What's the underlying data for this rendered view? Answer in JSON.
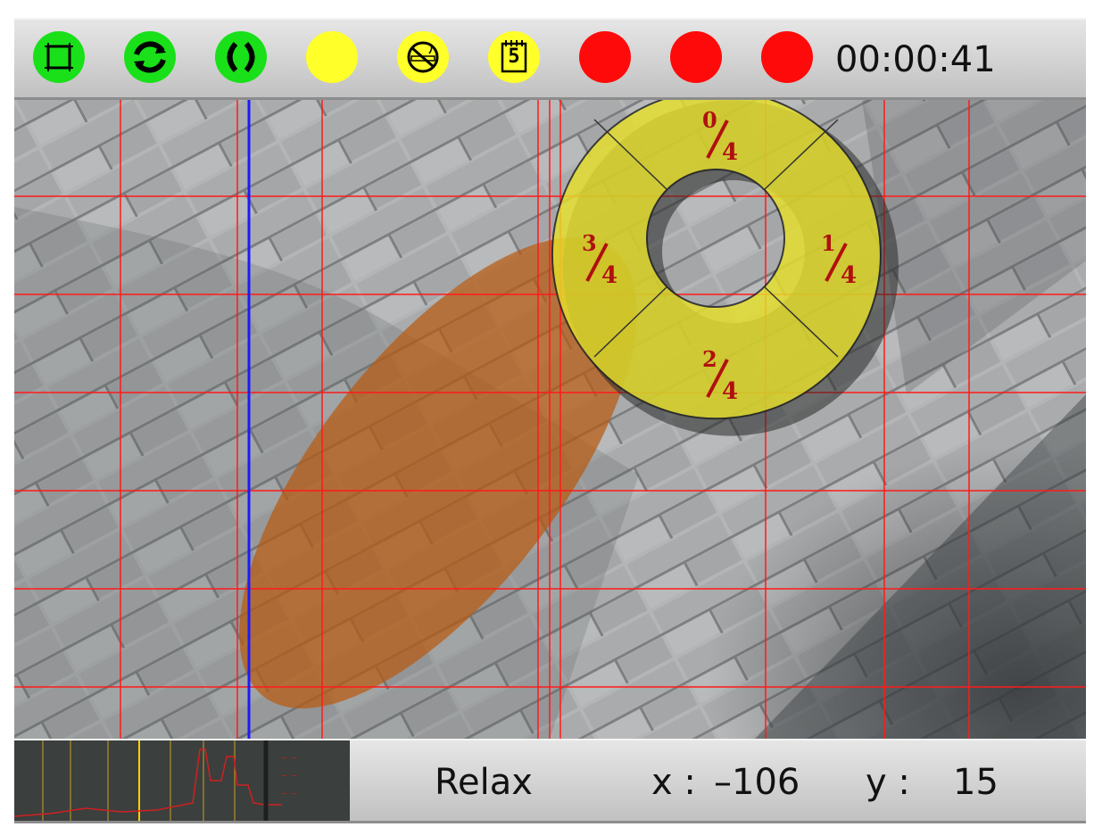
{
  "toolbar": {
    "indicators": [
      {
        "name": "frame-icon",
        "color": "#19e019"
      },
      {
        "name": "refresh-icon",
        "color": "#19e019"
      },
      {
        "name": "sync-parentheses-icon",
        "color": "#19e019"
      },
      {
        "name": "yellow-status-indicator",
        "color": "#ffff2a"
      },
      {
        "name": "no-smoking-icon",
        "color": "#ffff2a"
      },
      {
        "name": "calendar-5-icon",
        "color": "#ffff2a",
        "label": "5"
      },
      {
        "name": "red-status-indicator",
        "color": "#ff0a0a"
      },
      {
        "name": "red-status-indicator",
        "color": "#ff0a0a"
      },
      {
        "name": "red-status-indicator",
        "color": "#ff0a0a"
      }
    ],
    "timer": "00:00:41"
  },
  "dial": {
    "segments": [
      {
        "num": "0",
        "den": "4"
      },
      {
        "num": "1",
        "den": "4"
      },
      {
        "num": "2",
        "den": "4"
      },
      {
        "num": "3",
        "den": "4"
      }
    ],
    "fill_color": "#e6e02a",
    "label_color": "#b01010"
  },
  "overlay": {
    "grid_color": "#ff1a1a",
    "cursor_line_color": "#1a1aff",
    "ellipse_color": "#b85a10"
  },
  "status": {
    "mode": "Relax",
    "x_label": "x :",
    "x_value": "–106",
    "y_label": "y :",
    "y_value": "15"
  },
  "mini_plot": {
    "legend": [
      "— —",
      "— —",
      "— —"
    ]
  }
}
